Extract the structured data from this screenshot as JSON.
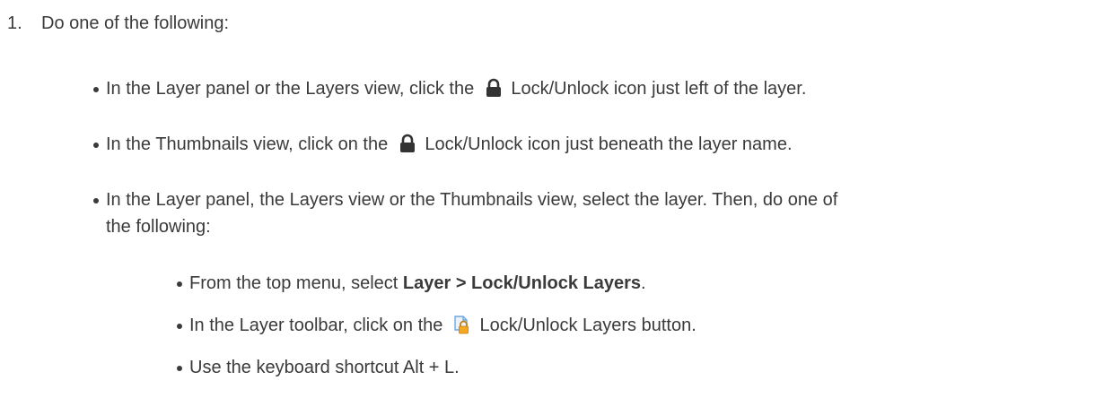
{
  "step": {
    "number": "1.",
    "text": "Do one of the following:"
  },
  "bullets": [
    {
      "before": "In the Layer panel or the Layers view, click the",
      "icon": "lock-icon",
      "after": "Lock/Unlock icon just left of the layer."
    },
    {
      "before": "In the Thumbnails view, click on the",
      "icon": "lock-icon",
      "after": "Lock/Unlock icon just beneath the layer name."
    },
    {
      "line1": "In the Layer panel, the Layers view or the Thumbnails view, select the layer. Then, do one of",
      "line2": "the following:"
    }
  ],
  "sub_bullets": [
    {
      "before": "From the top menu, select ",
      "bold": "Layer > Lock/Unlock Layers",
      "after": "."
    },
    {
      "before": "In the Layer toolbar, click on the",
      "icon": "lock-unlock-layers-button-icon",
      "after": "Lock/Unlock Layers button."
    },
    {
      "text": "Use the keyboard shortcut Alt + L."
    }
  ],
  "colors": {
    "text": "#3a3a3a",
    "lock_icon": "#333333",
    "layer_button_page": "#6fa8dc",
    "layer_button_lock": "#f5a623"
  }
}
